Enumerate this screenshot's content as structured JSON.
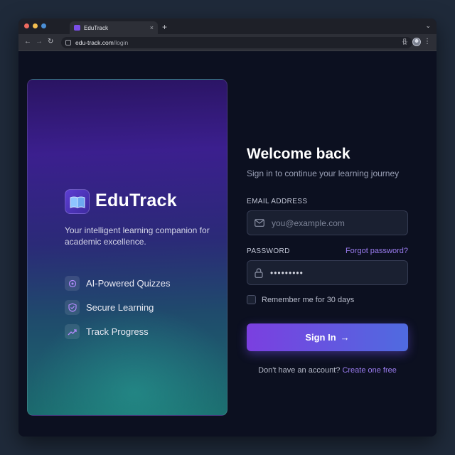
{
  "browser": {
    "tab_title": "EduTrack",
    "tab_close": "×",
    "new_tab": "+",
    "tab_menu": "⌄",
    "url_host": "edu-track.com",
    "url_path": "/login",
    "icons": [
      "back-arrow-icon",
      "forward-arrow-icon",
      "reload-icon",
      "site-info-icon",
      "star-icon",
      "sidebar-icon",
      "profile-avatar",
      "kebab-menu-icon"
    ]
  },
  "brand": {
    "name": "EduTrack",
    "tagline": "Your intelligent learning companion for academic excellence.",
    "features": [
      {
        "label": "AI-Powered Quizzes",
        "icon": "brain-icon"
      },
      {
        "label": "Secure Learning",
        "icon": "shield-icon"
      },
      {
        "label": "Track Progress",
        "icon": "trend-up-icon"
      }
    ],
    "accent": "#6b46e0"
  },
  "form": {
    "title": "Welcome back",
    "subtitle": "Sign in to continue your learning journey",
    "email_label": "EMAIL ADDRESS",
    "email_placeholder": "you@example.com",
    "password_label": "PASSWORD",
    "forgot_password": "Forgot password?",
    "password_value": "•••••••••",
    "remember_label": "Remember me for 30 days",
    "submit_label": "Sign In",
    "submit_arrow": "→",
    "signup_prompt": "Don't have an account?",
    "signup_link": "Create one free"
  }
}
